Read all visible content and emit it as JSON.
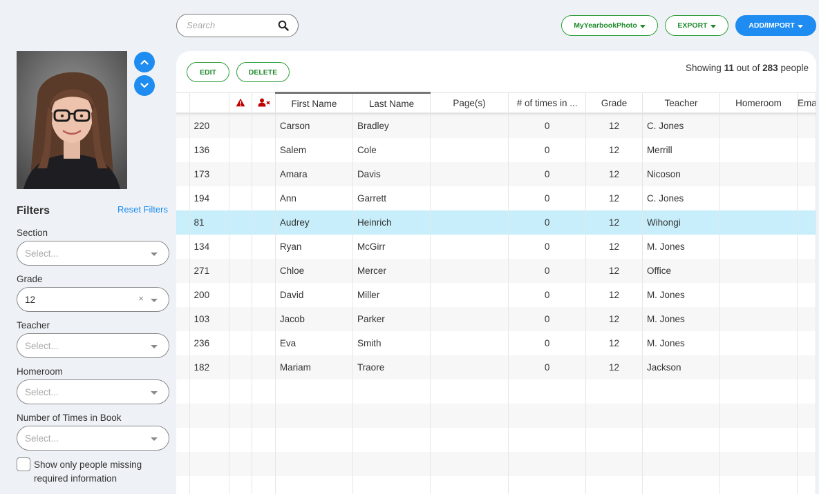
{
  "search": {
    "placeholder": "Search"
  },
  "top_buttons": {
    "mypic": "MyYearbookPhoto",
    "export": "EXPORT",
    "add": "ADD/IMPORT"
  },
  "filters": {
    "title": "Filters",
    "reset": "Reset Filters",
    "section_label": "Section",
    "section_value": "Select...",
    "grade_label": "Grade",
    "grade_value": "12",
    "teacher_label": "Teacher",
    "teacher_value": "Select...",
    "homeroom_label": "Homeroom",
    "homeroom_value": "Select...",
    "times_label": "Number of Times in Book",
    "times_value": "Select...",
    "missing_label": "Show only people missing required information",
    "clear_glyph": "×"
  },
  "actions": {
    "edit": "EDIT",
    "delete": "DELETE"
  },
  "showing": {
    "prefix": "Showing",
    "count": "11",
    "middle": "out of",
    "total": "283",
    "suffix": "people"
  },
  "table": {
    "headers": [
      "",
      "",
      "",
      "First Name",
      "Last Name",
      "Page(s)",
      "# of times in ...",
      "Grade",
      "Teacher",
      "Homeroom",
      "Email",
      ""
    ],
    "rows": [
      [
        "220",
        "Carson",
        "Bradley",
        "",
        "0",
        "12",
        "C. Jones"
      ],
      [
        "136",
        "Salem",
        "Cole",
        "",
        "0",
        "12",
        "Merrill"
      ],
      [
        "173",
        "Amara",
        "Davis",
        "",
        "0",
        "12",
        "Nicoson"
      ],
      [
        "194",
        "Ann",
        "Garrett",
        "",
        "0",
        "12",
        "C. Jones"
      ],
      [
        "81",
        "Audrey",
        "Heinrich",
        "",
        "0",
        "12",
        "Wihongi"
      ],
      [
        "134",
        "Ryan",
        "McGirr",
        "",
        "0",
        "12",
        "M. Jones"
      ],
      [
        "271",
        "Chloe",
        "Mercer",
        "",
        "0",
        "12",
        "Office"
      ],
      [
        "200",
        "David",
        "Miller",
        "",
        "0",
        "12",
        "M. Jones"
      ],
      [
        "103",
        "Jacob",
        "Parker",
        "",
        "0",
        "12",
        "M. Jones"
      ],
      [
        "236",
        "Eva",
        "Smith",
        "",
        "0",
        "12",
        "M. Jones"
      ],
      [
        "182",
        "Mariam",
        "Traore",
        "",
        "0",
        "12",
        "Jackson"
      ]
    ],
    "highlighted_row": 4,
    "empty_rows": 5
  },
  "colors": {
    "accent_blue": "#1e8cf0",
    "accent_green": "#1e8a2b",
    "highlight": "#c7eefa",
    "warning_red": "#c00000"
  }
}
